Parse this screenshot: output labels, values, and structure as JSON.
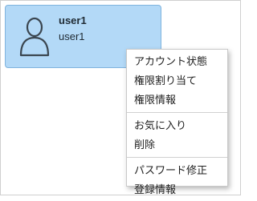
{
  "user_card": {
    "name": "user1",
    "username": "user1",
    "avatar_icon": "user-avatar-icon",
    "background_color": "#b3d9f7",
    "border_color": "#7fb3de"
  },
  "context_menu": {
    "groups": [
      {
        "items": [
          "アカウント状態",
          "権限割り当て",
          "権限情報"
        ]
      },
      {
        "items": [
          "お気に入り",
          "削除"
        ]
      },
      {
        "items": [
          "パスワード修正",
          "登録情報"
        ]
      }
    ]
  }
}
